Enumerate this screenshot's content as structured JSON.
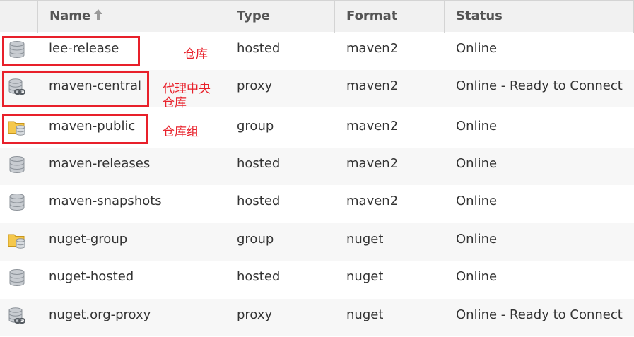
{
  "table": {
    "columns": {
      "name": "Name",
      "type": "Type",
      "format": "Format",
      "status": "Status"
    },
    "sort_indicator": "arrow-up-icon",
    "rows": [
      {
        "name": "lee-release",
        "type": "hosted",
        "format": "maven2",
        "status": "Online",
        "icon": "database-icon"
      },
      {
        "name": "maven-central",
        "type": "proxy",
        "format": "maven2",
        "status": "Online - Ready to Connect",
        "icon": "database-link-icon"
      },
      {
        "name": "maven-public",
        "type": "group",
        "format": "maven2",
        "status": "Online",
        "icon": "folder-database-icon"
      },
      {
        "name": "maven-releases",
        "type": "hosted",
        "format": "maven2",
        "status": "Online",
        "icon": "database-icon"
      },
      {
        "name": "maven-snapshots",
        "type": "hosted",
        "format": "maven2",
        "status": "Online",
        "icon": "database-icon"
      },
      {
        "name": "nuget-group",
        "type": "group",
        "format": "nuget",
        "status": "Online",
        "icon": "folder-database-icon"
      },
      {
        "name": "nuget-hosted",
        "type": "hosted",
        "format": "nuget",
        "status": "Online",
        "icon": "database-icon"
      },
      {
        "name": "nuget.org-proxy",
        "type": "proxy",
        "format": "nuget",
        "status": "Online - Ready to Connect",
        "icon": "database-link-icon"
      }
    ]
  },
  "annotations": {
    "hosted_note": "仓库",
    "proxy_note_line1": "代理中央",
    "proxy_note_line2": "仓库",
    "group_note": "仓库组",
    "color": "#e8202a"
  }
}
